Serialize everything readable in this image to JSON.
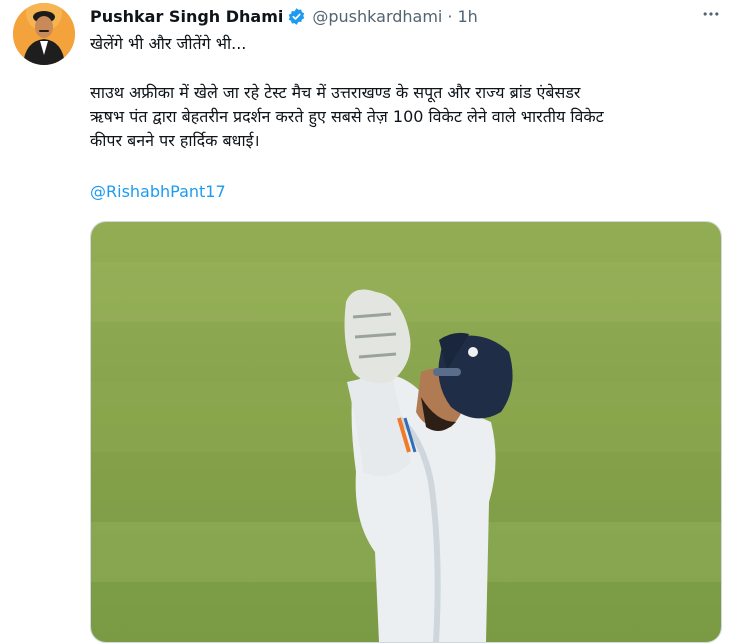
{
  "tweet": {
    "author": {
      "display_name": "Pushkar Singh Dhami",
      "verified_icon": "verified-badge-icon",
      "handle": "@pushkardhami",
      "separator": "·",
      "time": "1h",
      "avatar": "avatar-photo"
    },
    "more_icon": "more-horizontal-icon",
    "text": {
      "line1": "खेलेंगे भी और जीतेंगे भी...",
      "line2": "साउथ अफ्रीका में खेले जा रहे टेस्ट मैच में उत्तराखण्ड के सपूत और राज्य ब्रांड एंबेसडर",
      "line3": "ऋषभ पंत द्वारा बेहतरीन प्रदर्शन करते हुए सबसे तेज़ 100 विकेट लेने वाले भारतीय विकेट",
      "line4": "कीपर बनने पर हार्दिक बधाई।",
      "mention": "@RishabhPant17"
    },
    "media": {
      "type": "photo",
      "description_icon": "cricket-wicketkeeper-photo"
    },
    "colors": {
      "link": "#1d9bf0",
      "verified": "#1d9bf0",
      "secondary_text": "#536471",
      "primary_text": "#0f1419"
    }
  }
}
